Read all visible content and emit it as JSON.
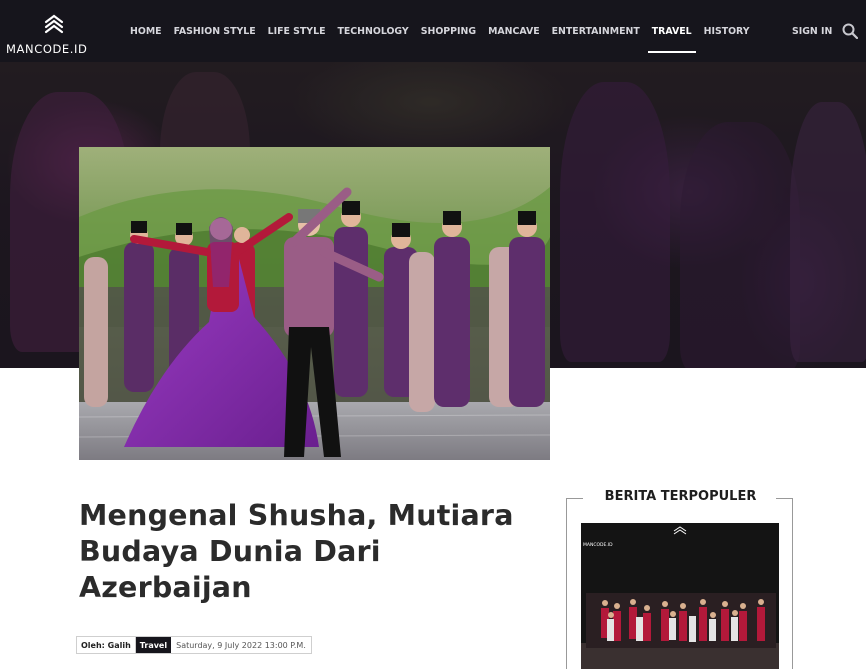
{
  "site": {
    "logo_text": "MANCODE.ID"
  },
  "nav": {
    "items": [
      {
        "label": "HOME",
        "active": false
      },
      {
        "label": "FASHION STYLE",
        "active": false
      },
      {
        "label": "LIFE STYLE",
        "active": false
      },
      {
        "label": "TECHNOLOGY",
        "active": false
      },
      {
        "label": "SHOPPING",
        "active": false
      },
      {
        "label": "MANCAVE",
        "active": false
      },
      {
        "label": "ENTERTAINMENT",
        "active": false
      },
      {
        "label": "TRAVEL",
        "active": true
      },
      {
        "label": "HISTORY",
        "active": false
      }
    ],
    "signin_label": "SIGN IN",
    "search_icon": "search-icon"
  },
  "article": {
    "title": "Mengenal Shusha, Mutiara Budaya Dunia Dari Azerbaijan",
    "author": "Oleh: Galih",
    "category": "Travel",
    "date": "Saturday, 9 July 2022 13:00 P.M."
  },
  "sidebar": {
    "heading": "BERITA TERPOPULER",
    "thumb_logo_text": "MANCODE.ID"
  },
  "colors": {
    "navbar_bg": "#16151c",
    "accent_dark": "#16151c",
    "costume_purple": "#7b2d8e",
    "costume_red": "#b3193a"
  }
}
